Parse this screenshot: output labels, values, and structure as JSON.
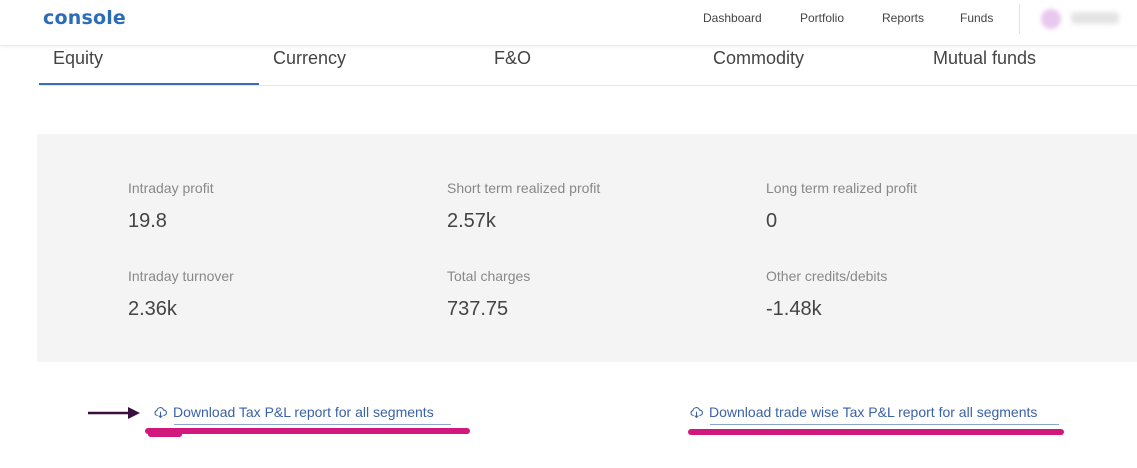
{
  "header": {
    "logo": "console",
    "nav": [
      "Dashboard",
      "Portfolio",
      "Reports",
      "Funds"
    ]
  },
  "tabs": [
    "Equity",
    "Currency",
    "F&O",
    "Commodity",
    "Mutual funds"
  ],
  "active_tab": "Equity",
  "summary": [
    {
      "label": "Intraday profit",
      "value": "19.8"
    },
    {
      "label": "Short term realized profit",
      "value": "2.57k"
    },
    {
      "label": "Long term realized profit",
      "value": "0"
    },
    {
      "label": "Intraday turnover",
      "value": "2.36k"
    },
    {
      "label": "Total charges",
      "value": "737.75"
    },
    {
      "label": "Other credits/debits",
      "value": "-1.48k"
    }
  ],
  "downloads": [
    {
      "label": "Download Tax P&L report for all segments"
    },
    {
      "label": "Download trade wise Tax P&L report for all segments"
    }
  ],
  "colors": {
    "brand": "#2b6cb8",
    "link": "#3a62a8",
    "tab_indicator": "#3a6fb5",
    "annotation": "#d1197d",
    "arrow": "#3a0f3f"
  },
  "icons": {
    "download": "cloud-download-icon",
    "pointer": "arrow-right-icon"
  }
}
